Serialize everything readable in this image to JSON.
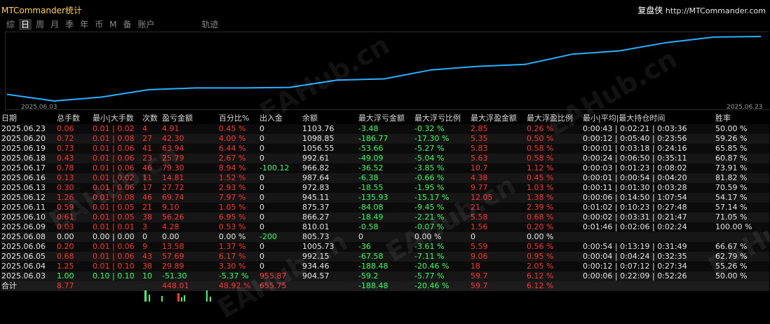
{
  "app": {
    "title": "MTCommander统计",
    "brand_cn": "复盘侠",
    "brand_url": "http://MTCommander.com"
  },
  "tabs": [
    {
      "label": "综",
      "active": false
    },
    {
      "label": "日",
      "active": true
    },
    {
      "label": "周",
      "active": false
    },
    {
      "label": "月",
      "active": false
    },
    {
      "label": "季",
      "active": false
    },
    {
      "label": "年",
      "active": false
    },
    {
      "label": "币",
      "active": false
    },
    {
      "label": "M",
      "active": false
    },
    {
      "label": "备",
      "active": false
    },
    {
      "label": "账户",
      "active": false
    },
    {
      "label": "轨迹",
      "active": false
    }
  ],
  "chart_data": {
    "type": "line",
    "x": [
      "2025.06.03",
      "2025.06.04",
      "2025.06.05",
      "2025.06.06",
      "2025.06.08",
      "2025.06.09",
      "2025.06.10",
      "2025.06.11",
      "2025.06.12",
      "2025.06.13",
      "2025.06.16",
      "2025.06.17",
      "2025.06.18",
      "2025.06.19",
      "2025.06.20",
      "2025.06.23"
    ],
    "values": [
      904.57,
      934.46,
      992.15,
      1005.73,
      1005.73,
      810.01,
      866.27,
      875.37,
      945.11,
      972.83,
      987.64,
      966.82,
      992.61,
      1056.55,
      1098.85,
      1103.76
    ],
    "series_color": "#2ab0ff",
    "x_start_label": "2025.06.03",
    "x_end_label": "2025.06.23",
    "grid": false
  },
  "table": {
    "headers": [
      "日期",
      "总手数",
      "最小|大手数",
      "次数",
      "盈亏金额",
      "百分比%",
      "出入金",
      "余额",
      "最大浮亏金额",
      "最大浮亏比例",
      "最大浮盈金额",
      "最大浮盈比例",
      "最小|平均|最大持仓时间",
      "胜率"
    ],
    "rows": [
      [
        "2025.06.23",
        "0.06",
        "0.01 | 0.02",
        "4",
        "4.91",
        "0.45 %",
        "0",
        "1103.76",
        "-3.48",
        "-0.32 %",
        "2.85",
        "0.26 %",
        "0:00:43 | 0:02:21 | 0:03:36",
        "50.00 %"
      ],
      [
        "2025.06.20",
        "0.72",
        "0.01 | 0.08",
        "27",
        "42.30",
        "4.00 %",
        "0",
        "1098.85",
        "-186.77",
        "-17.30 %",
        "5.35",
        "0.50 %",
        "0:00:12 | 0:05:40 | 0:23:56",
        "59.26 %"
      ],
      [
        "2025.06.19",
        "0.73",
        "0.01 | 0.06",
        "41",
        "63.94",
        "6.44 %",
        "0",
        "1056.55",
        "-53.66",
        "-5.27 %",
        "5.83",
        "0.58 %",
        "0:00:01 | 0:03:18 | 0:24:16",
        "65.85 %"
      ],
      [
        "2025.06.18",
        "0.43",
        "0.01 | 0.06",
        "23",
        "25.79",
        "2.67 %",
        "0",
        "992.61",
        "-49.09",
        "-5.04 %",
        "5.63",
        "0.58 %",
        "0:00:24 | 0:06:50 | 0:35:11",
        "60.87 %"
      ],
      [
        "2025.06.17",
        "0.78",
        "0.01 | 0.06",
        "46",
        "79.30",
        "8.94 %",
        "-100.12",
        "966.82",
        "-36.52",
        "-3.85 %",
        "10.7",
        "1.12 %",
        "0:00:03 | 0:01:23 | 0:08:02",
        "73.91 %"
      ],
      [
        "2025.06.16",
        "0.13",
        "0.01 | 0.02",
        "11",
        "14.81",
        "1.52 %",
        "0",
        "987.64",
        "-6.38",
        "-0.66 %",
        "4.38",
        "0.45 %",
        "0:00:01 | 0:00:54 | 0:04:20",
        "81.82 %"
      ],
      [
        "2025.06.13",
        "0.30",
        "0.01 | 0.06",
        "17",
        "27.72",
        "2.93 %",
        "0",
        "972.83",
        "-18.55",
        "-1.95 %",
        "9.77",
        "1.03 %",
        "0:00:11 | 0:01:30 | 0:03:28",
        "70.59 %"
      ],
      [
        "2025.06.12",
        "1.26",
        "0.01 | 0.08",
        "46",
        "69.74",
        "7.97 %",
        "0",
        "945.11",
        "-135.93",
        "-15.17 %",
        "12.05",
        "1.38 %",
        "0:00:06 | 0:14:50 | 1:07:54",
        "54.17 %"
      ],
      [
        "2025.06.11",
        "0.59",
        "0.01 | 0.05",
        "21",
        "9.10",
        "1.05 %",
        "0",
        "875.37",
        "-84.08",
        "-9.45 %",
        "21",
        "2.39 %",
        "0:01:02 | 0:10:23 | 0:27:48",
        "57.14 %"
      ],
      [
        "2025.06.10",
        "0.61",
        "0.01 | 0.05",
        "38",
        "56.26",
        "6.95 %",
        "0",
        "866.27",
        "-18.49",
        "-2.21 %",
        "5.58",
        "0.68 %",
        "0:00:02 | 0:03:31 | 0:21:47",
        "71.05 %"
      ],
      [
        "2025.06.09",
        "0.03",
        "0.01 | 0.01",
        "3",
        "4.28",
        "0.53 %",
        "0",
        "810.01",
        "-0.58",
        "-0.07 %",
        "1.56",
        "0.20 %",
        "0:01:46 | 0:02:06 | 0:02:24",
        "100.00 %"
      ],
      [
        "2025.06.08",
        "0.00",
        "0.00 | 0.00",
        "0",
        "0.00",
        "0.00 %",
        "-200",
        "805.73",
        "0",
        "0.00 %",
        "0",
        "0.00 %",
        "",
        ""
      ],
      [
        "2025.06.06",
        "0.20",
        "0.01 | 0.06",
        "9",
        "13.58",
        "1.37 %",
        "0",
        "1005.73",
        "-36",
        "-3.61 %",
        "5.59",
        "0.56 %",
        "0:00:54 | 0:13:19 | 0:31:49",
        "66.67 %"
      ],
      [
        "2025.06.05",
        "0.68",
        "0.01 | 0.06",
        "43",
        "57.69",
        "6.17 %",
        "0",
        "992.15",
        "-67.58",
        "-7.11 %",
        "9.06",
        "0.95 %",
        "0:00:04 | 0:04:24 | 0:32:35",
        "62.79 %"
      ],
      [
        "2025.06.04",
        "1.25",
        "0.01 | 0.10",
        "38",
        "29.89",
        "3.30 %",
        "0",
        "934.46",
        "-188.48",
        "-20.46 %",
        "18",
        "2.05 %",
        "0:00:12 | 0:07:12 | 0:27:34",
        "55.26 %"
      ],
      [
        "2025.06.03",
        "1.00",
        "0.10 | 0.10",
        "10",
        "-51.30",
        "-5.37 %",
        "955.87",
        "904.57",
        "-59.2",
        "-5.77 %",
        "59.7",
        "6.12 %",
        "0:00:06 | 0:22:09 | 0:52:26",
        "50.00 %"
      ]
    ],
    "row_colors": [
      [
        "white",
        "red",
        "red",
        "red",
        "red",
        "red",
        "white",
        "white",
        "green",
        "green",
        "red",
        "red",
        "white",
        "white"
      ],
      [
        "white",
        "red",
        "red",
        "red",
        "red",
        "red",
        "white",
        "white",
        "green",
        "green",
        "red",
        "red",
        "white",
        "white"
      ],
      [
        "white",
        "red",
        "red",
        "red",
        "red",
        "red",
        "white",
        "white",
        "green",
        "green",
        "red",
        "red",
        "white",
        "white"
      ],
      [
        "white",
        "red",
        "red",
        "red",
        "red",
        "red",
        "white",
        "white",
        "green",
        "green",
        "red",
        "red",
        "white",
        "white"
      ],
      [
        "white",
        "red",
        "red",
        "red",
        "red",
        "red",
        "green",
        "white",
        "green",
        "green",
        "red",
        "red",
        "white",
        "white"
      ],
      [
        "white",
        "red",
        "red",
        "red",
        "red",
        "red",
        "white",
        "white",
        "green",
        "green",
        "red",
        "red",
        "white",
        "white"
      ],
      [
        "white",
        "red",
        "red",
        "red",
        "red",
        "red",
        "white",
        "white",
        "green",
        "green",
        "red",
        "red",
        "white",
        "white"
      ],
      [
        "white",
        "red",
        "red",
        "red",
        "red",
        "red",
        "white",
        "white",
        "green",
        "green",
        "red",
        "red",
        "white",
        "white"
      ],
      [
        "white",
        "red",
        "red",
        "red",
        "red",
        "red",
        "white",
        "white",
        "green",
        "green",
        "red",
        "red",
        "white",
        "white"
      ],
      [
        "white",
        "red",
        "red",
        "red",
        "red",
        "red",
        "white",
        "white",
        "green",
        "green",
        "red",
        "red",
        "white",
        "white"
      ],
      [
        "white",
        "red",
        "red",
        "red",
        "red",
        "red",
        "white",
        "white",
        "green",
        "green",
        "red",
        "red",
        "white",
        "white"
      ],
      [
        "white",
        "white",
        "white",
        "white",
        "white",
        "white",
        "green",
        "white",
        "white",
        "white",
        "white",
        "white",
        "white",
        "white"
      ],
      [
        "white",
        "red",
        "red",
        "red",
        "red",
        "red",
        "white",
        "white",
        "green",
        "green",
        "red",
        "red",
        "white",
        "white"
      ],
      [
        "white",
        "red",
        "red",
        "red",
        "red",
        "red",
        "white",
        "white",
        "green",
        "green",
        "red",
        "red",
        "white",
        "white"
      ],
      [
        "white",
        "red",
        "red",
        "red",
        "red",
        "red",
        "white",
        "white",
        "green",
        "green",
        "red",
        "red",
        "white",
        "white"
      ],
      [
        "white",
        "green",
        "green",
        "green",
        "green",
        "green",
        "red",
        "white",
        "green",
        "green",
        "red",
        "red",
        "white",
        "white"
      ]
    ],
    "total": {
      "label": "合计",
      "lots": "8.77",
      "pnl": "448.01",
      "pct": "48.92 %",
      "io": "655.75",
      "max_float_loss": "-188.48",
      "max_float_loss_pct": "-20.46 %",
      "max_float_profit": "59.7",
      "max_float_profit_pct": "6.12 %"
    }
  },
  "watermark": "EAHub.cn",
  "colors": {
    "profit": "#ff3333",
    "loss": "#33ff66",
    "line": "#2ab0ff",
    "title": "#ffd84a"
  }
}
